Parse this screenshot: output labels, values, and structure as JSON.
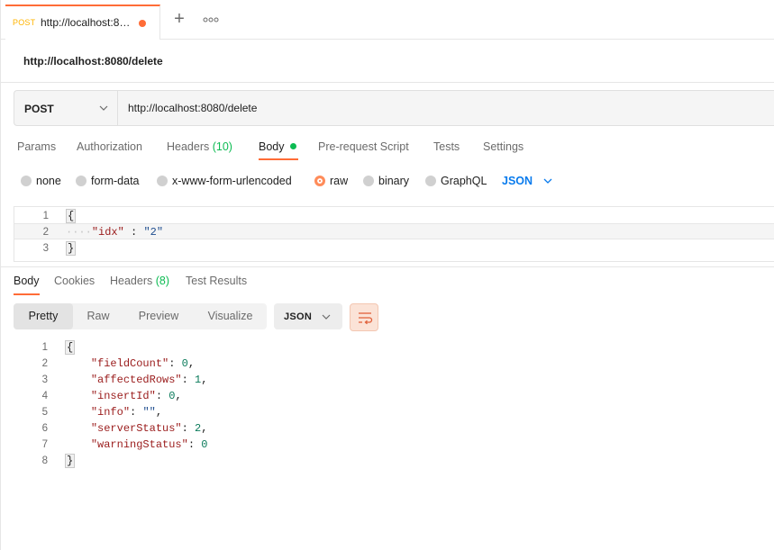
{
  "tab": {
    "method": "POST",
    "url": "http://localhost:8…"
  },
  "request": {
    "title": "http://localhost:8080/delete",
    "method": "POST",
    "url": "http://localhost:8080/delete"
  },
  "request_tabs": [
    {
      "label": "Params"
    },
    {
      "label": "Authorization"
    },
    {
      "label": "Headers",
      "count": "(10)"
    },
    {
      "label": "Body"
    },
    {
      "label": "Pre-request Script"
    },
    {
      "label": "Tests"
    },
    {
      "label": "Settings"
    }
  ],
  "body_types": [
    "none",
    "form-data",
    "x-www-form-urlencoded",
    "raw",
    "binary",
    "GraphQL"
  ],
  "body_selected": "raw",
  "body_format": "JSON",
  "request_body": {
    "line_numbers": [
      "1",
      "2",
      "3"
    ],
    "open": "{",
    "indent": "····",
    "key": "\"idx\"",
    "sep": " : ",
    "value": "\"2\"",
    "close": "}"
  },
  "response_tabs": [
    {
      "label": "Body"
    },
    {
      "label": "Cookies"
    },
    {
      "label": "Headers",
      "count": "(8)"
    },
    {
      "label": "Test Results"
    }
  ],
  "view_modes": [
    "Pretty",
    "Raw",
    "Preview",
    "Visualize"
  ],
  "response_format": "JSON",
  "response_body": {
    "line_numbers": [
      "1",
      "2",
      "3",
      "4",
      "5",
      "6",
      "7",
      "8"
    ],
    "open": "{",
    "close": "}",
    "entries": [
      {
        "key": "\"fieldCount\"",
        "value": "0",
        "type": "n",
        "comma": ","
      },
      {
        "key": "\"affectedRows\"",
        "value": "1",
        "type": "n",
        "comma": ","
      },
      {
        "key": "\"insertId\"",
        "value": "0",
        "type": "n",
        "comma": ","
      },
      {
        "key": "\"info\"",
        "value": "\"\"",
        "type": "s",
        "comma": ","
      },
      {
        "key": "\"serverStatus\"",
        "value": "2",
        "type": "n",
        "comma": ","
      },
      {
        "key": "\"warningStatus\"",
        "value": "0",
        "type": "n",
        "comma": ""
      }
    ]
  },
  "colors": {
    "accent": "#ff6c37",
    "success": "#0cbb52",
    "link": "#097bed"
  }
}
